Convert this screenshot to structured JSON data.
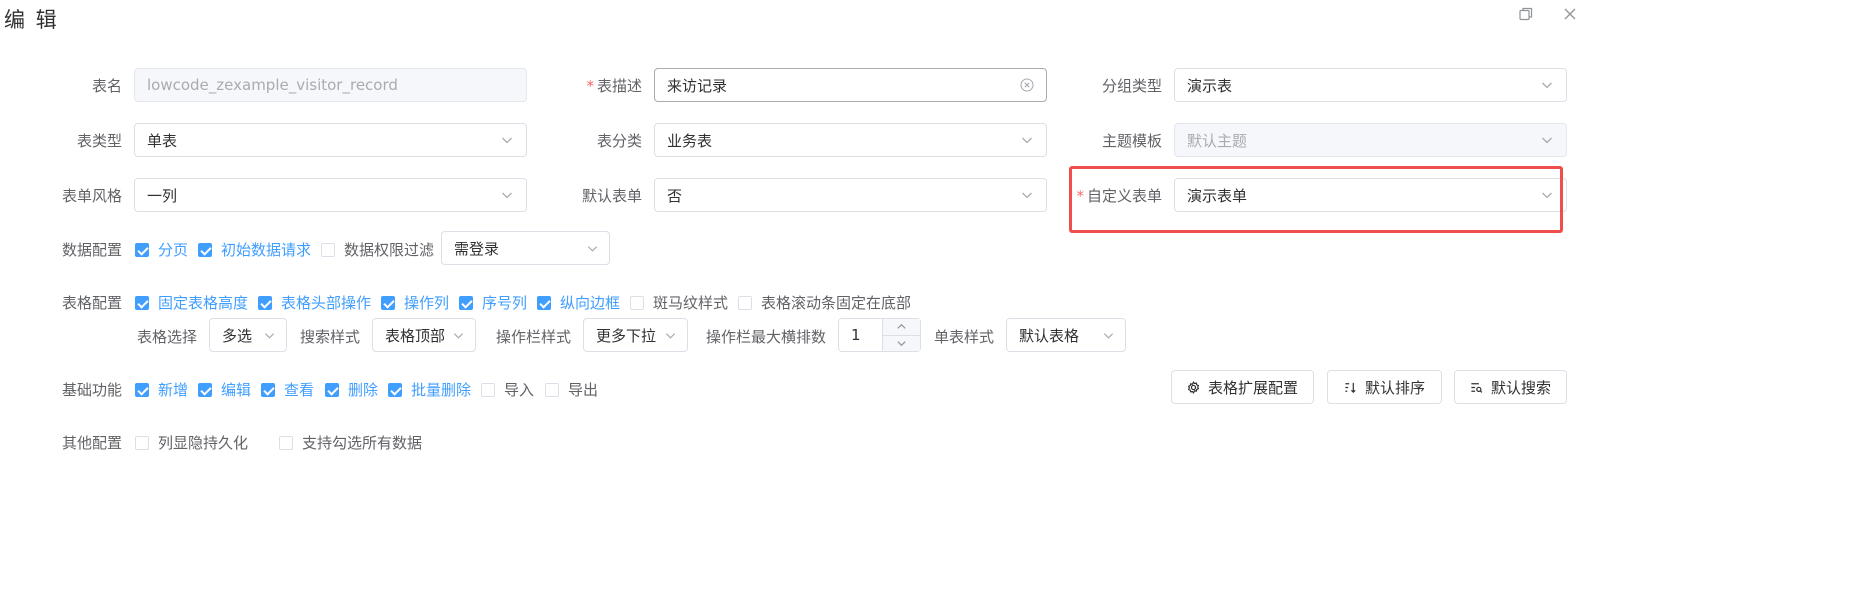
{
  "dialog": {
    "title": "编 辑"
  },
  "basic": {
    "table_name": {
      "label": "表名",
      "value": "lowcode_zexample_visitor_record"
    },
    "table_desc": {
      "label": "表描述",
      "required_mark": "*",
      "value": "来访记录"
    },
    "group_type": {
      "label": "分组类型",
      "value": "演示表"
    },
    "table_type": {
      "label": "表类型",
      "value": "单表"
    },
    "table_category": {
      "label": "表分类",
      "value": "业务表"
    },
    "theme_template": {
      "label": "主题模板",
      "value": "默认主题"
    },
    "form_style": {
      "label": "表单风格",
      "value": "一列"
    },
    "default_form": {
      "label": "默认表单",
      "value": "否"
    },
    "custom_form": {
      "label": "自定义表单",
      "required_mark": "*",
      "value": "演示表单"
    }
  },
  "data_config": {
    "label": "数据配置",
    "options": [
      {
        "label": "分页",
        "checked": true
      },
      {
        "label": "初始数据请求",
        "checked": true
      },
      {
        "label": "数据权限过滤",
        "checked": false
      }
    ],
    "login_select": "需登录"
  },
  "table_config": {
    "label": "表格配置",
    "options": [
      {
        "label": "固定表格高度",
        "checked": true
      },
      {
        "label": "表格头部操作",
        "checked": true
      },
      {
        "label": "操作列",
        "checked": true
      },
      {
        "label": "序号列",
        "checked": true
      },
      {
        "label": "纵向边框",
        "checked": true
      },
      {
        "label": "斑马纹样式",
        "checked": false
      },
      {
        "label": "表格滚动条固定在底部",
        "checked": false
      }
    ],
    "table_select_label": "表格选择",
    "table_select_value": "多选",
    "search_style_label": "搜索样式",
    "search_style_value": "表格顶部",
    "action_style_label": "操作栏样式",
    "action_style_value": "更多下拉",
    "action_max_label": "操作栏最大横排数",
    "action_max_value": "1",
    "single_style_label": "单表样式",
    "single_style_value": "默认表格"
  },
  "basic_functions": {
    "label": "基础功能",
    "options": [
      {
        "label": "新增",
        "checked": true
      },
      {
        "label": "编辑",
        "checked": true
      },
      {
        "label": "查看",
        "checked": true
      },
      {
        "label": "删除",
        "checked": true
      },
      {
        "label": "批量删除",
        "checked": true
      },
      {
        "label": "导入",
        "checked": false
      },
      {
        "label": "导出",
        "checked": false
      }
    ],
    "buttons": {
      "ext_config": "表格扩展配置",
      "default_sort": "默认排序",
      "default_search": "默认搜索"
    }
  },
  "other_config": {
    "label": "其他配置",
    "options": [
      {
        "label": "列显隐持久化",
        "checked": false
      },
      {
        "label": "支持勾选所有数据",
        "checked": false
      }
    ]
  },
  "colors": {
    "primary": "#409eff",
    "required": "#f56c6c",
    "highlight_border": "#f04d4d"
  }
}
